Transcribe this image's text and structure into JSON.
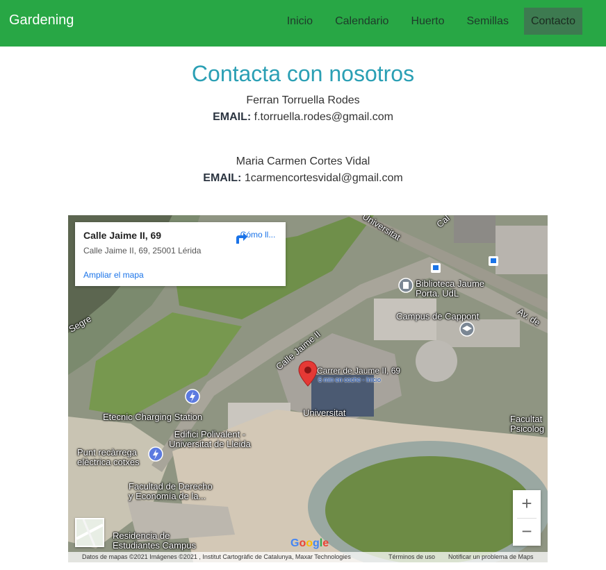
{
  "navbar": {
    "brand": "Gardening",
    "items": [
      {
        "label": "Inicio"
      },
      {
        "label": "Calendario"
      },
      {
        "label": "Huerto"
      },
      {
        "label": "Semillas"
      },
      {
        "label": "Contacto",
        "active": true
      }
    ],
    "bg_color": "#28a745"
  },
  "main": {
    "title": "Contacta con nosotros",
    "contacts": [
      {
        "name": "Ferran Torruella Rodes",
        "email_label": "EMAIL:",
        "email": "f.torruella.rodes@gmail.com"
      },
      {
        "name": "Maria Carmen Cortes Vidal",
        "email_label": "EMAIL:",
        "email": "1carmencortesvidal@gmail.com"
      }
    ]
  },
  "map": {
    "card": {
      "title": "Calle Jaime II, 69",
      "address": "Calle Jaime II, 69, 25001 Lérida",
      "directions": "Cómo ll...",
      "enlarge": "Ampliar el mapa"
    },
    "labels": {
      "segre": "Segre",
      "universitat_road": "Universitat",
      "biblioteca": "Biblioteca Jaume\nPorta. UdL",
      "campus": "Campus de Cappont",
      "calle_jaime": "Calle Jaime II",
      "pin_title": "Carrer de Jaume II, 69",
      "pin_sub": "6 min en coche - Inicio",
      "universitat": "Universitat",
      "etecnic": "Etecnic Charging Station",
      "edifici": "Edifici Polivalent -\nUniversitat de Lleida",
      "punt": "Punt recàrrega\nelèctrica cotxes",
      "facultad": "Facultad de Derecho\ny Economía de la...",
      "residencia": "Residencia de\nEstudiantes Campus",
      "facultat": "Facultat\nPsicolog",
      "av": "Av. de",
      "cal": "Cal"
    },
    "zoom_in": "+",
    "zoom_out": "−",
    "google": "Google",
    "footer": {
      "data": "Datos de mapas ©2021 Imágenes ©2021 , Institut Cartogràfic de Catalunya, Maxar Technologies",
      "terms": "Términos de uso",
      "report": "Notificar un problema de Maps"
    }
  }
}
